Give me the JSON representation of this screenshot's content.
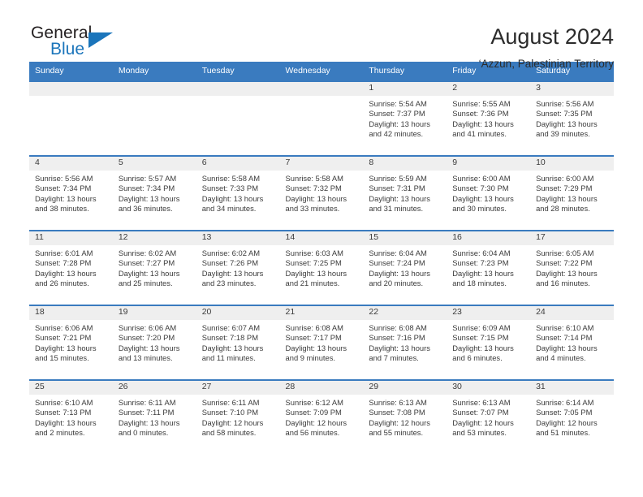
{
  "logo": {
    "primary_text": "General",
    "secondary_text": "Blue",
    "primary_color": "#231f20",
    "accent_color": "#1b75bb"
  },
  "header": {
    "title": "August 2024",
    "subtitle": "‘Azzun, Palestinian Territory"
  },
  "theme": {
    "header_blue": "#3a7bbf",
    "daynum_band": "#efefef",
    "text": "#3b3b3b"
  },
  "weekday_headers": [
    "Sunday",
    "Monday",
    "Tuesday",
    "Wednesday",
    "Thursday",
    "Friday",
    "Saturday"
  ],
  "weeks": [
    [
      {
        "day": "",
        "sunrise": "",
        "sunset": "",
        "daylight_line1": "",
        "daylight_line2": ""
      },
      {
        "day": "",
        "sunrise": "",
        "sunset": "",
        "daylight_line1": "",
        "daylight_line2": ""
      },
      {
        "day": "",
        "sunrise": "",
        "sunset": "",
        "daylight_line1": "",
        "daylight_line2": ""
      },
      {
        "day": "",
        "sunrise": "",
        "sunset": "",
        "daylight_line1": "",
        "daylight_line2": ""
      },
      {
        "day": "1",
        "sunrise": "Sunrise: 5:54 AM",
        "sunset": "Sunset: 7:37 PM",
        "daylight_line1": "Daylight: 13 hours",
        "daylight_line2": "and 42 minutes."
      },
      {
        "day": "2",
        "sunrise": "Sunrise: 5:55 AM",
        "sunset": "Sunset: 7:36 PM",
        "daylight_line1": "Daylight: 13 hours",
        "daylight_line2": "and 41 minutes."
      },
      {
        "day": "3",
        "sunrise": "Sunrise: 5:56 AM",
        "sunset": "Sunset: 7:35 PM",
        "daylight_line1": "Daylight: 13 hours",
        "daylight_line2": "and 39 minutes."
      }
    ],
    [
      {
        "day": "4",
        "sunrise": "Sunrise: 5:56 AM",
        "sunset": "Sunset: 7:34 PM",
        "daylight_line1": "Daylight: 13 hours",
        "daylight_line2": "and 38 minutes."
      },
      {
        "day": "5",
        "sunrise": "Sunrise: 5:57 AM",
        "sunset": "Sunset: 7:34 PM",
        "daylight_line1": "Daylight: 13 hours",
        "daylight_line2": "and 36 minutes."
      },
      {
        "day": "6",
        "sunrise": "Sunrise: 5:58 AM",
        "sunset": "Sunset: 7:33 PM",
        "daylight_line1": "Daylight: 13 hours",
        "daylight_line2": "and 34 minutes."
      },
      {
        "day": "7",
        "sunrise": "Sunrise: 5:58 AM",
        "sunset": "Sunset: 7:32 PM",
        "daylight_line1": "Daylight: 13 hours",
        "daylight_line2": "and 33 minutes."
      },
      {
        "day": "8",
        "sunrise": "Sunrise: 5:59 AM",
        "sunset": "Sunset: 7:31 PM",
        "daylight_line1": "Daylight: 13 hours",
        "daylight_line2": "and 31 minutes."
      },
      {
        "day": "9",
        "sunrise": "Sunrise: 6:00 AM",
        "sunset": "Sunset: 7:30 PM",
        "daylight_line1": "Daylight: 13 hours",
        "daylight_line2": "and 30 minutes."
      },
      {
        "day": "10",
        "sunrise": "Sunrise: 6:00 AM",
        "sunset": "Sunset: 7:29 PM",
        "daylight_line1": "Daylight: 13 hours",
        "daylight_line2": "and 28 minutes."
      }
    ],
    [
      {
        "day": "11",
        "sunrise": "Sunrise: 6:01 AM",
        "sunset": "Sunset: 7:28 PM",
        "daylight_line1": "Daylight: 13 hours",
        "daylight_line2": "and 26 minutes."
      },
      {
        "day": "12",
        "sunrise": "Sunrise: 6:02 AM",
        "sunset": "Sunset: 7:27 PM",
        "daylight_line1": "Daylight: 13 hours",
        "daylight_line2": "and 25 minutes."
      },
      {
        "day": "13",
        "sunrise": "Sunrise: 6:02 AM",
        "sunset": "Sunset: 7:26 PM",
        "daylight_line1": "Daylight: 13 hours",
        "daylight_line2": "and 23 minutes."
      },
      {
        "day": "14",
        "sunrise": "Sunrise: 6:03 AM",
        "sunset": "Sunset: 7:25 PM",
        "daylight_line1": "Daylight: 13 hours",
        "daylight_line2": "and 21 minutes."
      },
      {
        "day": "15",
        "sunrise": "Sunrise: 6:04 AM",
        "sunset": "Sunset: 7:24 PM",
        "daylight_line1": "Daylight: 13 hours",
        "daylight_line2": "and 20 minutes."
      },
      {
        "day": "16",
        "sunrise": "Sunrise: 6:04 AM",
        "sunset": "Sunset: 7:23 PM",
        "daylight_line1": "Daylight: 13 hours",
        "daylight_line2": "and 18 minutes."
      },
      {
        "day": "17",
        "sunrise": "Sunrise: 6:05 AM",
        "sunset": "Sunset: 7:22 PM",
        "daylight_line1": "Daylight: 13 hours",
        "daylight_line2": "and 16 minutes."
      }
    ],
    [
      {
        "day": "18",
        "sunrise": "Sunrise: 6:06 AM",
        "sunset": "Sunset: 7:21 PM",
        "daylight_line1": "Daylight: 13 hours",
        "daylight_line2": "and 15 minutes."
      },
      {
        "day": "19",
        "sunrise": "Sunrise: 6:06 AM",
        "sunset": "Sunset: 7:20 PM",
        "daylight_line1": "Daylight: 13 hours",
        "daylight_line2": "and 13 minutes."
      },
      {
        "day": "20",
        "sunrise": "Sunrise: 6:07 AM",
        "sunset": "Sunset: 7:18 PM",
        "daylight_line1": "Daylight: 13 hours",
        "daylight_line2": "and 11 minutes."
      },
      {
        "day": "21",
        "sunrise": "Sunrise: 6:08 AM",
        "sunset": "Sunset: 7:17 PM",
        "daylight_line1": "Daylight: 13 hours",
        "daylight_line2": "and 9 minutes."
      },
      {
        "day": "22",
        "sunrise": "Sunrise: 6:08 AM",
        "sunset": "Sunset: 7:16 PM",
        "daylight_line1": "Daylight: 13 hours",
        "daylight_line2": "and 7 minutes."
      },
      {
        "day": "23",
        "sunrise": "Sunrise: 6:09 AM",
        "sunset": "Sunset: 7:15 PM",
        "daylight_line1": "Daylight: 13 hours",
        "daylight_line2": "and 6 minutes."
      },
      {
        "day": "24",
        "sunrise": "Sunrise: 6:10 AM",
        "sunset": "Sunset: 7:14 PM",
        "daylight_line1": "Daylight: 13 hours",
        "daylight_line2": "and 4 minutes."
      }
    ],
    [
      {
        "day": "25",
        "sunrise": "Sunrise: 6:10 AM",
        "sunset": "Sunset: 7:13 PM",
        "daylight_line1": "Daylight: 13 hours",
        "daylight_line2": "and 2 minutes."
      },
      {
        "day": "26",
        "sunrise": "Sunrise: 6:11 AM",
        "sunset": "Sunset: 7:11 PM",
        "daylight_line1": "Daylight: 13 hours",
        "daylight_line2": "and 0 minutes."
      },
      {
        "day": "27",
        "sunrise": "Sunrise: 6:11 AM",
        "sunset": "Sunset: 7:10 PM",
        "daylight_line1": "Daylight: 12 hours",
        "daylight_line2": "and 58 minutes."
      },
      {
        "day": "28",
        "sunrise": "Sunrise: 6:12 AM",
        "sunset": "Sunset: 7:09 PM",
        "daylight_line1": "Daylight: 12 hours",
        "daylight_line2": "and 56 minutes."
      },
      {
        "day": "29",
        "sunrise": "Sunrise: 6:13 AM",
        "sunset": "Sunset: 7:08 PM",
        "daylight_line1": "Daylight: 12 hours",
        "daylight_line2": "and 55 minutes."
      },
      {
        "day": "30",
        "sunrise": "Sunrise: 6:13 AM",
        "sunset": "Sunset: 7:07 PM",
        "daylight_line1": "Daylight: 12 hours",
        "daylight_line2": "and 53 minutes."
      },
      {
        "day": "31",
        "sunrise": "Sunrise: 6:14 AM",
        "sunset": "Sunset: 7:05 PM",
        "daylight_line1": "Daylight: 12 hours",
        "daylight_line2": "and 51 minutes."
      }
    ]
  ]
}
